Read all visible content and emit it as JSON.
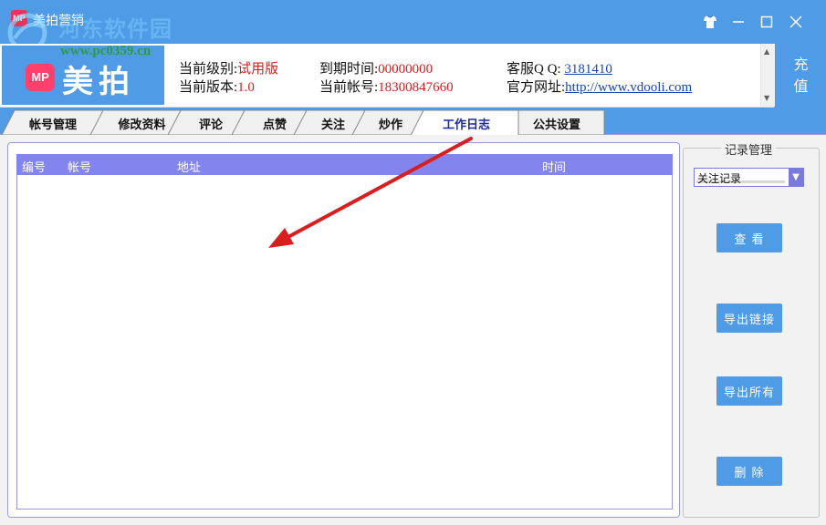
{
  "window": {
    "app_title": "美拍营销",
    "watermark_name": "河东软件园",
    "watermark_url": "www.pc0359.cn"
  },
  "header": {
    "logo_badge": "MP",
    "logo_text": "美拍",
    "level_label": "当前级别:",
    "level_value": "试用版",
    "version_label": "当前版本:",
    "version_value": "1.0",
    "expiry_label": "到期时间:",
    "expiry_value": "00000000",
    "account_label": "当前帐号:",
    "account_value": "18300847660",
    "qq_label": "客服Q Q: ",
    "qq_value": "3181410",
    "site_label": "官方网址:",
    "site_value": "http://www.vdooli.com",
    "recharge": [
      "充",
      "值"
    ]
  },
  "tabs": [
    {
      "label": "帐号管理",
      "active": false
    },
    {
      "label": "修改资料",
      "active": false
    },
    {
      "label": "评论",
      "active": false
    },
    {
      "label": "点赞",
      "active": false
    },
    {
      "label": "关注",
      "active": false
    },
    {
      "label": "炒作",
      "active": false
    },
    {
      "label": "工作日志",
      "active": true
    },
    {
      "label": "公共设置",
      "active": false
    }
  ],
  "table": {
    "columns": [
      "编号",
      "帐号",
      "地址",
      "时间"
    ],
    "rows": []
  },
  "side": {
    "group_title": "记录管理",
    "select_value": "关注记录",
    "buttons": [
      "查 看",
      "导出链接",
      "导出所有",
      "删 除"
    ]
  },
  "colors": {
    "chrome": "#4f9be6",
    "table_header": "#8484ee",
    "value_red": "#d12020",
    "link_blue": "#1a46b8",
    "arrow_red": "#d81e1e"
  },
  "icons": {
    "skin": "shirt-icon",
    "minimize": "minimize-icon",
    "maximize": "maximize-icon",
    "close": "close-icon"
  }
}
